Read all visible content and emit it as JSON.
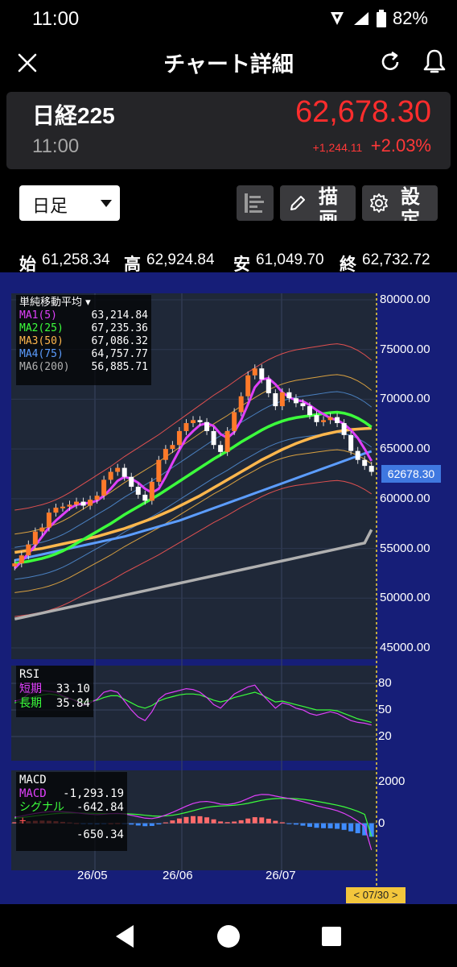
{
  "status": {
    "time": "11:00",
    "battery": "82%"
  },
  "header": {
    "title": "チャート詳細"
  },
  "quote": {
    "name": "日経225",
    "time": "11:00",
    "price": "62,678.30",
    "change_abs": "+1,244.11",
    "change_pct": "+2.03%",
    "up_color": "#ff2d2d"
  },
  "toolbar": {
    "period": "日足",
    "draw_label": "描画",
    "settings_label": "設定"
  },
  "ohlc": [
    {
      "key": "始",
      "value": "61,258.34"
    },
    {
      "key": "高",
      "value": "62,924.84"
    },
    {
      "key": "安",
      "value": "61,049.70"
    },
    {
      "key": "終",
      "value": "62,732.72"
    }
  ],
  "legend": {
    "title": "単純移動平均",
    "rows": [
      {
        "label": "MA1(5)",
        "value": "63,214.84",
        "color": "#e040fb"
      },
      {
        "label": "MA2(25)",
        "value": "67,235.36",
        "color": "#3cff3c"
      },
      {
        "label": "MA3(50)",
        "value": "67,086.32",
        "color": "#ffb74d"
      },
      {
        "label": "MA4(75)",
        "value": "64,757.77",
        "color": "#5c9dff"
      },
      {
        "label": "MA6(200)",
        "value": "56,885.71",
        "color": "#b0b0b0"
      }
    ]
  },
  "rsi_legend": {
    "title": "RSI",
    "rows": [
      {
        "label": "短期",
        "value": "33.10",
        "color": "#e040fb"
      },
      {
        "label": "長期",
        "value": "35.84",
        "color": "#3cff3c"
      }
    ]
  },
  "macd_legend": {
    "title": "MACD",
    "macd_label": "MACD",
    "macd_value": "-1,293.19",
    "signal_label": "シグナル",
    "signal_value": "-642.84",
    "hist_label": "+",
    "hist_value": "-650.34"
  },
  "current_price_tag": "62678.30",
  "current_date_tag": "< 07/30 >",
  "chart_data": {
    "type": "candlestick",
    "y_axis_labels": [
      "80000.00",
      "75000.00",
      "70000.00",
      "65000.00",
      "60000.00",
      "55000.00",
      "50000.00",
      "45000.00"
    ],
    "ylim": [
      45000,
      80000
    ],
    "x_axis_labels": [
      "26/05",
      "26/06",
      "26/07"
    ],
    "closes": [
      53500,
      54300,
      55400,
      56700,
      57100,
      58600,
      59100,
      59200,
      59400,
      59700,
      59300,
      59900,
      60300,
      61900,
      62700,
      63100,
      62200,
      61200,
      60400,
      59800,
      61700,
      63900,
      65000,
      65400,
      66800,
      67600,
      67900,
      67700,
      66800,
      65400,
      64700,
      66800,
      68700,
      70300,
      72400,
      73100,
      72000,
      70600,
      69300,
      70700,
      70100,
      69600,
      69300,
      68400,
      67700,
      67900,
      68200,
      67600,
      66400,
      64800,
      63900,
      63300,
      62700
    ],
    "ma_series": [
      {
        "name": "MA1(5)",
        "color": "#e040fb",
        "values": [
          53000,
          53700,
          54500,
          55300,
          56200,
          57100,
          57800,
          58400,
          59000,
          59400,
          59500,
          59600,
          59800,
          60300,
          61000,
          61800,
          62200,
          62000,
          61600,
          61000,
          60600,
          61000,
          62200,
          63600,
          64900,
          66100,
          66800,
          67400,
          67600,
          67300,
          66500,
          66100,
          66700,
          67900,
          69500,
          71200,
          72000,
          72100,
          71500,
          70700,
          70200,
          69900,
          69800,
          69400,
          68900,
          68500,
          68100,
          67900,
          67500,
          66900,
          66100,
          65000,
          63800
        ]
      },
      {
        "name": "MA2(25)",
        "color": "#3cff3c",
        "values": [
          53500,
          53600,
          53700,
          53850,
          54000,
          54200,
          54450,
          54750,
          55100,
          55500,
          55900,
          56300,
          56700,
          57100,
          57500,
          57950,
          58400,
          58800,
          59200,
          59600,
          60000,
          60400,
          60850,
          61300,
          61750,
          62200,
          62650,
          63100,
          63550,
          64000,
          64400,
          64800,
          65250,
          65700,
          66100,
          66500,
          66900,
          67250,
          67550,
          67800,
          68000,
          68150,
          68250,
          68350,
          68450,
          68550,
          68650,
          68700,
          68600,
          68400,
          68100,
          67700,
          67200
        ]
      },
      {
        "name": "MA3(50)",
        "color": "#ffb74d",
        "values": [
          54600,
          54700,
          54800,
          54900,
          55000,
          55150,
          55300,
          55450,
          55600,
          55750,
          55900,
          56050,
          56200,
          56400,
          56600,
          56800,
          57000,
          57250,
          57500,
          57750,
          58000,
          58300,
          58600,
          58900,
          59250,
          59600,
          59950,
          60300,
          60700,
          61100,
          61500,
          61900,
          62300,
          62700,
          63100,
          63500,
          63900,
          64250,
          64600,
          64950,
          65250,
          65550,
          65800,
          66050,
          66250,
          66450,
          66600,
          66750,
          66850,
          66950,
          67000,
          67050,
          67080
        ]
      },
      {
        "name": "MA4(75)",
        "color": "#5c9dff",
        "values": [
          53800,
          53950,
          54100,
          54250,
          54400,
          54550,
          54700,
          54850,
          55000,
          55150,
          55300,
          55450,
          55600,
          55750,
          55900,
          56050,
          56200,
          56400,
          56600,
          56800,
          57000,
          57200,
          57400,
          57600,
          57800,
          58050,
          58300,
          58550,
          58800,
          59050,
          59300,
          59550,
          59800,
          60050,
          60300,
          60550,
          60800,
          61050,
          61300,
          61550,
          61800,
          62050,
          62300,
          62550,
          62800,
          63050,
          63300,
          63550,
          63800,
          64050,
          64300,
          64550,
          64760
        ]
      },
      {
        "name": "MA6(200)",
        "color": "#b0b0b0",
        "values": [
          47900,
          48050,
          48200,
          48350,
          48500,
          48650,
          48800,
          48950,
          49100,
          49250,
          49400,
          49550,
          49700,
          49850,
          50000,
          50150,
          50300,
          50450,
          50600,
          50750,
          50900,
          51050,
          51200,
          51350,
          51500,
          51650,
          51800,
          51950,
          52100,
          52250,
          52400,
          52550,
          52700,
          52850,
          53000,
          53150,
          53300,
          53450,
          53600,
          53750,
          53900,
          54050,
          54200,
          54350,
          54500,
          54650,
          54800,
          54950,
          55100,
          55250,
          55400,
          55550,
          56885
        ]
      }
    ],
    "rsi": {
      "y_axis_labels": [
        "80",
        "50",
        "20"
      ],
      "ylim": [
        0,
        100
      ],
      "short": [
        60,
        62,
        68,
        70,
        72,
        71,
        70,
        66,
        63,
        60,
        55,
        58,
        62,
        70,
        72,
        70,
        60,
        50,
        42,
        38,
        48,
        62,
        68,
        70,
        72,
        74,
        73,
        70,
        64,
        56,
        52,
        60,
        68,
        72,
        76,
        78,
        68,
        60,
        52,
        58,
        56,
        52,
        50,
        46,
        44,
        46,
        48,
        46,
        42,
        38,
        36,
        35,
        33
      ],
      "long": [
        58,
        60,
        63,
        65,
        67,
        68,
        67,
        65,
        63,
        61,
        59,
        60,
        61,
        64,
        66,
        66,
        62,
        58,
        54,
        52,
        55,
        60,
        63,
        65,
        67,
        68,
        68,
        67,
        64,
        61,
        59,
        61,
        64,
        66,
        68,
        70,
        67,
        63,
        59,
        60,
        58,
        56,
        54,
        52,
        50,
        50,
        50,
        49,
        46,
        43,
        40,
        38,
        36
      ]
    },
    "macd": {
      "y_axis_labels": [
        "2000",
        "0"
      ],
      "macd": [
        300,
        350,
        420,
        480,
        530,
        560,
        570,
        560,
        540,
        510,
        470,
        440,
        420,
        440,
        470,
        480,
        450,
        390,
        320,
        250,
        230,
        290,
        400,
        530,
        680,
        830,
        960,
        1040,
        1060,
        1010,
        930,
        910,
        960,
        1060,
        1200,
        1340,
        1400,
        1390,
        1320,
        1260,
        1200,
        1130,
        1050,
        950,
        850,
        770,
        700,
        610,
        480,
        310,
        100,
        -150,
        -1293
      ],
      "signal": [
        250,
        280,
        320,
        360,
        400,
        440,
        470,
        490,
        500,
        500,
        495,
        485,
        475,
        470,
        470,
        472,
        468,
        452,
        426,
        390,
        358,
        344,
        356,
        390,
        448,
        524,
        611,
        697,
        770,
        818,
        840,
        854,
        875,
        912,
        969,
        1043,
        1114,
        1169,
        1199,
        1211,
        1209,
        1193,
        1164,
        1121,
        1067,
        1007,
        945,
        878,
        798,
        700,
        580,
        434,
        -643
      ]
    }
  }
}
